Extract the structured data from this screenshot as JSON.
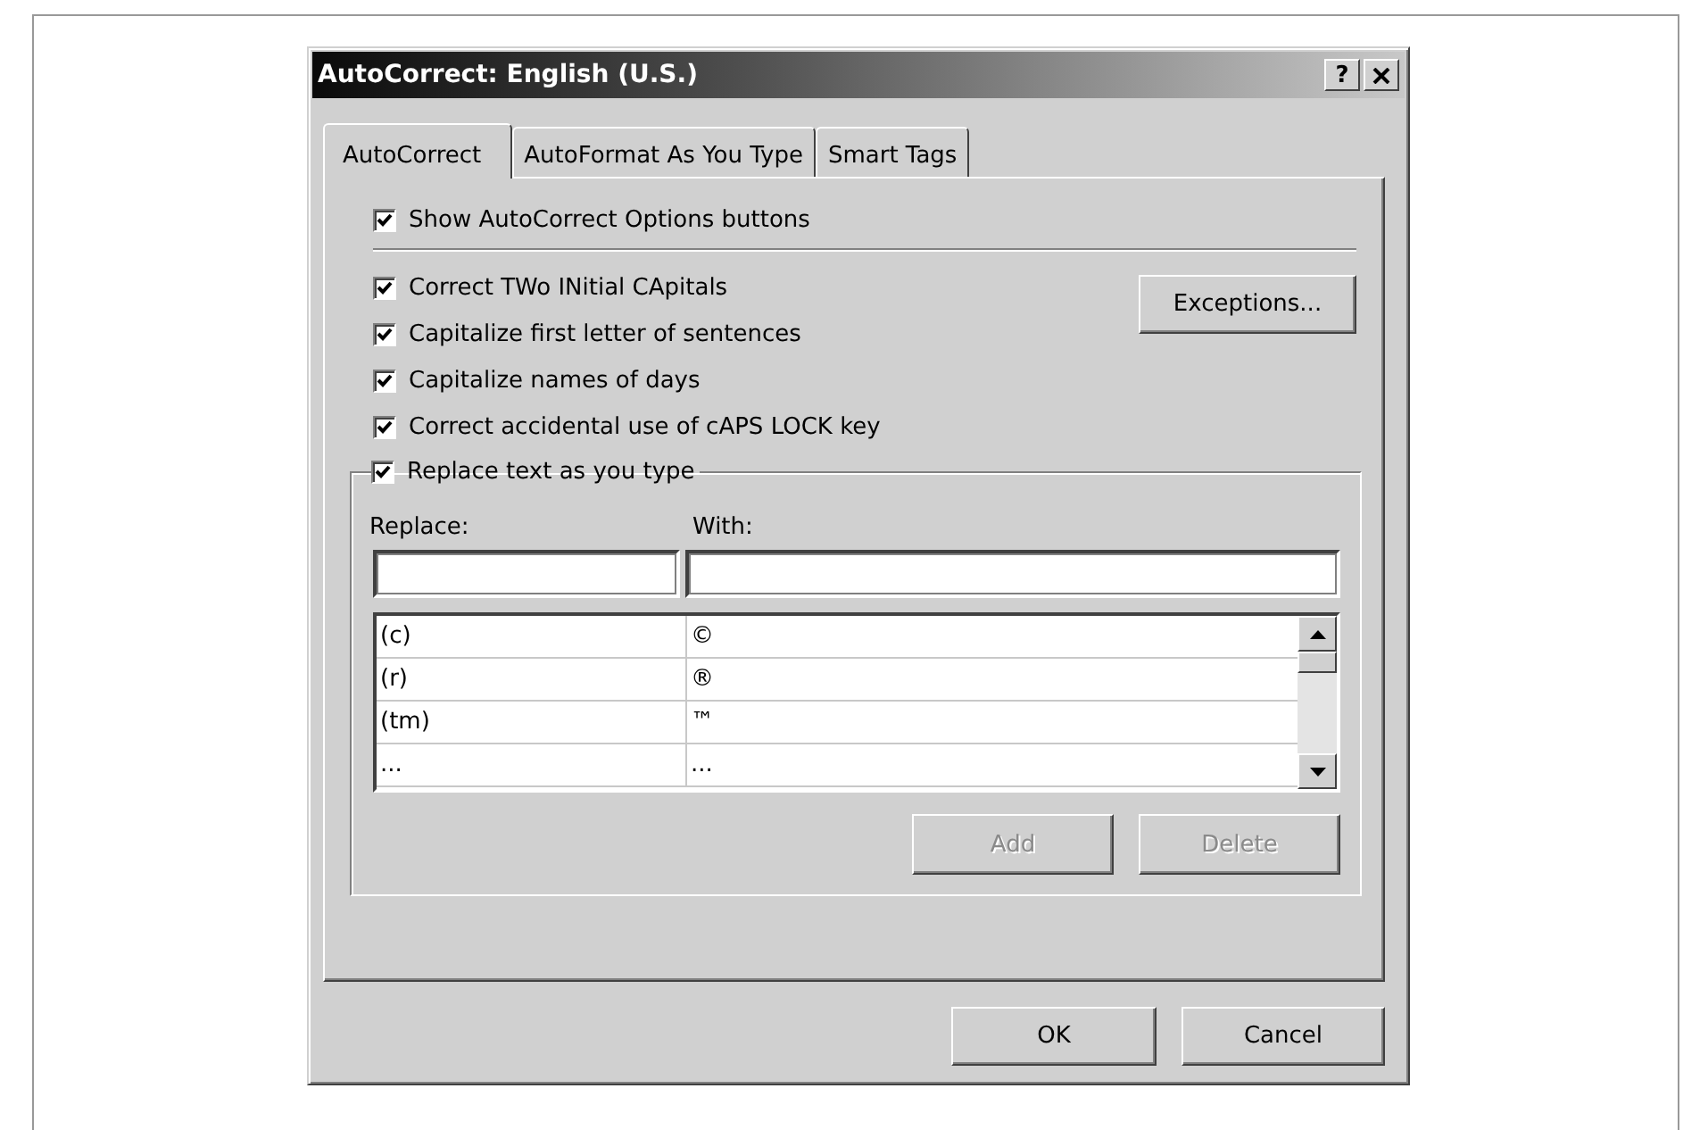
{
  "window": {
    "title": "AutoCorrect: English (U.S.)",
    "help_button": "?"
  },
  "tabs": [
    {
      "label": "AutoCorrect",
      "selected": true
    },
    {
      "label": "AutoFormat As You Type",
      "selected": false
    },
    {
      "label": "Smart Tags",
      "selected": false
    }
  ],
  "show_options": {
    "label": "Show AutoCorrect Options buttons",
    "checked": true
  },
  "options": [
    {
      "label": "Correct TWo INitial CApitals",
      "checked": true
    },
    {
      "label": "Capitalize first letter of sentences",
      "checked": true
    },
    {
      "label": "Capitalize names of days",
      "checked": true
    },
    {
      "label": "Correct accidental use of cAPS LOCK key",
      "checked": true
    }
  ],
  "exceptions_button": {
    "label": "Exceptions...",
    "disabled": false
  },
  "replace_group": {
    "label": "Replace text as you type",
    "checked": true,
    "replace_label": "Replace:",
    "with_label": "With:",
    "entries": [
      {
        "replace": "(c)",
        "with": "©"
      },
      {
        "replace": "(r)",
        "with": "®"
      },
      {
        "replace": "(tm)",
        "with": "™"
      },
      {
        "replace": "...",
        "with": "..."
      }
    ],
    "buttons": [
      {
        "label": "Add",
        "disabled": true
      },
      {
        "label": "Delete",
        "disabled": true
      }
    ]
  },
  "buttons": [
    {
      "label": "OK",
      "disabled": false
    },
    {
      "label": "Cancel",
      "disabled": false
    }
  ]
}
